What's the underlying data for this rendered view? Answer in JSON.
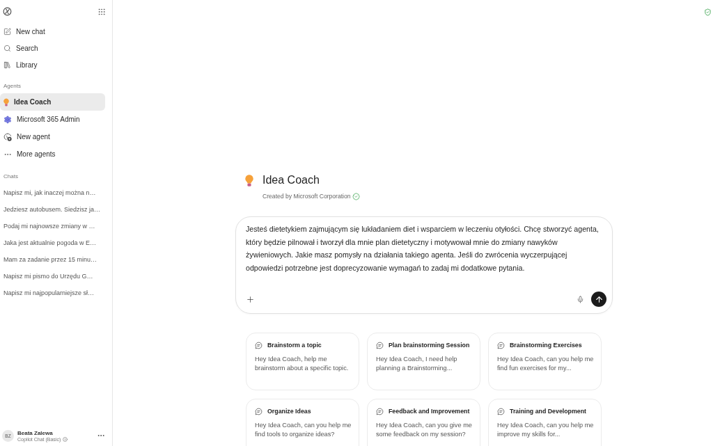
{
  "sidebar": {
    "nav": [
      {
        "label": "New chat"
      },
      {
        "label": "Search"
      },
      {
        "label": "Library"
      }
    ],
    "agents_label": "Agents",
    "agents": [
      {
        "label": "Idea Coach",
        "selected": true
      },
      {
        "label": "Microsoft 365 Admin",
        "selected": false
      },
      {
        "label": "New agent",
        "selected": false
      },
      {
        "label": "More agents",
        "selected": false
      }
    ],
    "chats_label": "Chats",
    "chats": [
      {
        "label": "Napisz mi, jak inaczej można n…",
        "selected": false
      },
      {
        "label": "Jedziesz autobusem. Siedzisz ja…",
        "selected": false
      },
      {
        "label": "Podaj mi najnowsze zmiany w …",
        "selected": false
      },
      {
        "label": "Jaka jest aktualnie pogoda w E…",
        "selected": false
      },
      {
        "label": "Mam za zadanie przez 15 minu…",
        "selected": false
      },
      {
        "label": "Napisz mi pismo do Urzędu G…",
        "selected": false
      },
      {
        "label": "Napisz mi najpopularniejsze sł…",
        "selected": false
      }
    ],
    "user": {
      "initials": "BZ",
      "name": "Beata Zalewa",
      "plan": "Copilot Chat (Basic)"
    }
  },
  "agent": {
    "name": "Idea Coach",
    "creator": "Created by Microsoft Corporation"
  },
  "composer": {
    "value": "Jesteś dietetykiem zajmującym się lukładaniem diet i wsparciem w leczeniu otyłości. Chcę stworzyć agenta, który będzie pilnował i tworzył dla mnie plan dietetyczny i motywował mnie do zmiany nawyków żywieniowych. Jakie masz pomysły na działania takiego agenta. Jeśli do zwrócenia wyczerpującej odpowiedzi potrzebne jest doprecyzowanie wymagań to zadaj mi dodatkowe pytania."
  },
  "suggestions": [
    {
      "title": "Brainstorm a topic",
      "prompt": "Hey Idea Coach, help me brainstorm about a specific topic."
    },
    {
      "title": "Plan brainstorming Session",
      "prompt": "Hey Idea Coach, I need help planning a Brainstorming..."
    },
    {
      "title": "Brainstorming Exercises",
      "prompt": "Hey Idea Coach, can you help me find fun exercises for my..."
    },
    {
      "title": "Organize Ideas",
      "prompt": "Hey Idea Coach, can you help me find tools to organize ideas?"
    },
    {
      "title": "Feedback and Improvement",
      "prompt": "Hey Idea Coach, can you give me some feedback on my session?"
    },
    {
      "title": "Training and Development",
      "prompt": "Hey Idea Coach, can you help me improve my skills for..."
    }
  ]
}
